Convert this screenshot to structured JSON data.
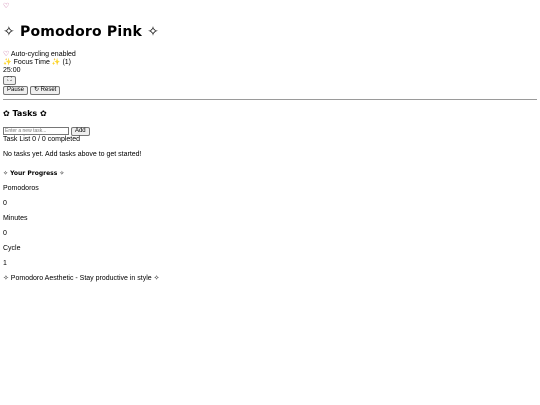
{
  "header": {
    "top_icon": "♡",
    "title": "✧ Pomodoro Pink ✧"
  },
  "timer": {
    "auto_cycle_icon": "♡",
    "auto_cycle_text": "Auto-cycling enabled",
    "mode_label": "✨ Focus Time ✨ (1)",
    "time": "25:00",
    "fullscreen_icon": "⛶",
    "pause_label": "Pause",
    "reset_icon": "↻",
    "reset_label": "Reset"
  },
  "tasks": {
    "title": "✿ Tasks ✿",
    "input_placeholder": "Enter a new task...",
    "add_label": "Add",
    "summary": "Task List 0 / 0 completed",
    "empty_message": "No tasks yet. Add tasks above to get started!"
  },
  "progress": {
    "title": "✧ Your Progress ✧",
    "stats": [
      {
        "label": "Pomodoros",
        "value": "0"
      },
      {
        "label": "Minutes",
        "value": "0"
      },
      {
        "label": "Cycle",
        "value": "1"
      }
    ]
  },
  "footer": {
    "text": "✧ Pomodoro Aesthetic - Stay productive in style ✧"
  },
  "colors": {
    "heart": "#b0307a",
    "sparkle": "#d4a017",
    "divider": "#9a9a9a"
  },
  "icons": {
    "top": "heart-icon",
    "auto_cycle": "heart-icon",
    "fullscreen": "fullscreen-icon",
    "reset": "refresh-icon"
  }
}
